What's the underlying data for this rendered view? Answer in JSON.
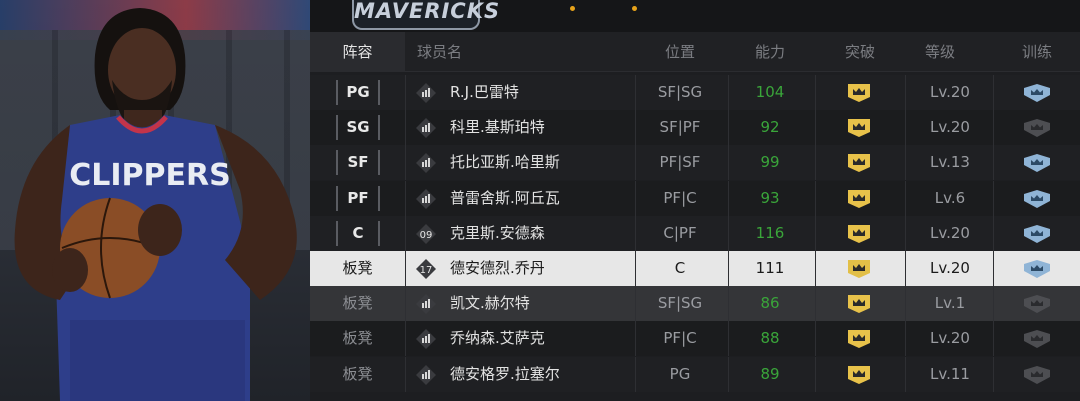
{
  "team": {
    "logo_text": "MAVERICKS"
  },
  "header": {
    "lineup": "阵容",
    "player_name": "球员名",
    "position": "位置",
    "ability": "能力",
    "breakthrough": "突破",
    "level": "等级",
    "training": "训练"
  },
  "players": [
    {
      "slot": "PG",
      "jersey": "",
      "name": "R.J.巴雷特",
      "position": "SF|SG",
      "ability": "104",
      "level": "Lv.20",
      "training": "active"
    },
    {
      "slot": "SG",
      "jersey": "",
      "name": "科里.基斯珀特",
      "position": "SF|PF",
      "ability": "92",
      "level": "Lv.20",
      "training": "inactive"
    },
    {
      "slot": "SF",
      "jersey": "",
      "name": "托比亚斯.哈里斯",
      "position": "PF|SF",
      "ability": "99",
      "level": "Lv.13",
      "training": "active"
    },
    {
      "slot": "PF",
      "jersey": "",
      "name": "普雷舍斯.阿丘瓦",
      "position": "PF|C",
      "ability": "93",
      "level": "Lv.6",
      "training": "active"
    },
    {
      "slot": "C",
      "jersey": "09",
      "name": "克里斯.安德森",
      "position": "C|PF",
      "ability": "116",
      "level": "Lv.20",
      "training": "active"
    },
    {
      "slot": "板凳",
      "jersey": "17",
      "name": "德安德烈.乔丹",
      "position": "C",
      "ability": "111",
      "level": "Lv.20",
      "training": "active"
    },
    {
      "slot": "板凳",
      "jersey": "",
      "name": "凯文.赫尔特",
      "position": "SF|SG",
      "ability": "86",
      "level": "Lv.1",
      "training": "inactive"
    },
    {
      "slot": "板凳",
      "jersey": "",
      "name": "乔纳森.艾萨克",
      "position": "PF|C",
      "ability": "88",
      "level": "Lv.20",
      "training": "inactive"
    },
    {
      "slot": "板凳",
      "jersey": "",
      "name": "德安格罗.拉塞尔",
      "position": "PG",
      "ability": "89",
      "level": "Lv.11",
      "training": "inactive"
    }
  ],
  "art": {
    "jersey_text": "CLIPPERS"
  },
  "colors": {
    "ability_green": "#3aa53a",
    "crown_gold": "#e8c24a",
    "train_blue": "#8fb4d6",
    "selected_row": "#e7e7e7"
  }
}
